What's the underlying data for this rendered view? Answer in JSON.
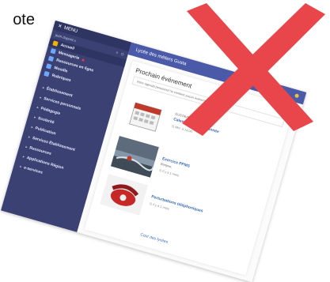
{
  "caption": "ote",
  "sidebar": {
    "menu_label": "MENU",
    "user_name": "jean.dupont.x",
    "items": [
      {
        "label": "Accueil",
        "active": true
      },
      {
        "label": "Messagerie",
        "badge": true
      },
      {
        "label": "Ressources en ligne"
      },
      {
        "label": "Moodle"
      },
      {
        "label": "Rubriques"
      }
    ],
    "categories": [
      "Établissement",
      "Services personnels",
      "Pédagogie",
      "Scolarité",
      "Publication",
      "Services Établissement",
      "Ressources",
      "Applications Région",
      "e-services"
    ]
  },
  "header": {
    "title": "Lycée des métiers Gusta"
  },
  "card": {
    "title": "Prochain événement",
    "subtitle": "Votre agenda personnel ne contient aucun événement",
    "events": [
      {
        "title": "Calendrier de fin d'année",
        "school": "GUSTAVE EIFFEL",
        "time": "Mer. à 14:00"
      },
      {
        "title": "Exercice PPMS",
        "school": "Bonjour,",
        "time": "Il y a 1 mois"
      },
      {
        "title": "Perturbations téléphoniques",
        "school": "",
        "time": "Il y a 1 mois"
      }
    ],
    "link": "Cour des lycées"
  },
  "colors": {
    "sidebar": "#3b4172",
    "topbar": "#4a5aa9",
    "cross": "#e9464b"
  },
  "icons": {
    "close": "close-icon",
    "cross_overlay": "red-cross-icon"
  }
}
